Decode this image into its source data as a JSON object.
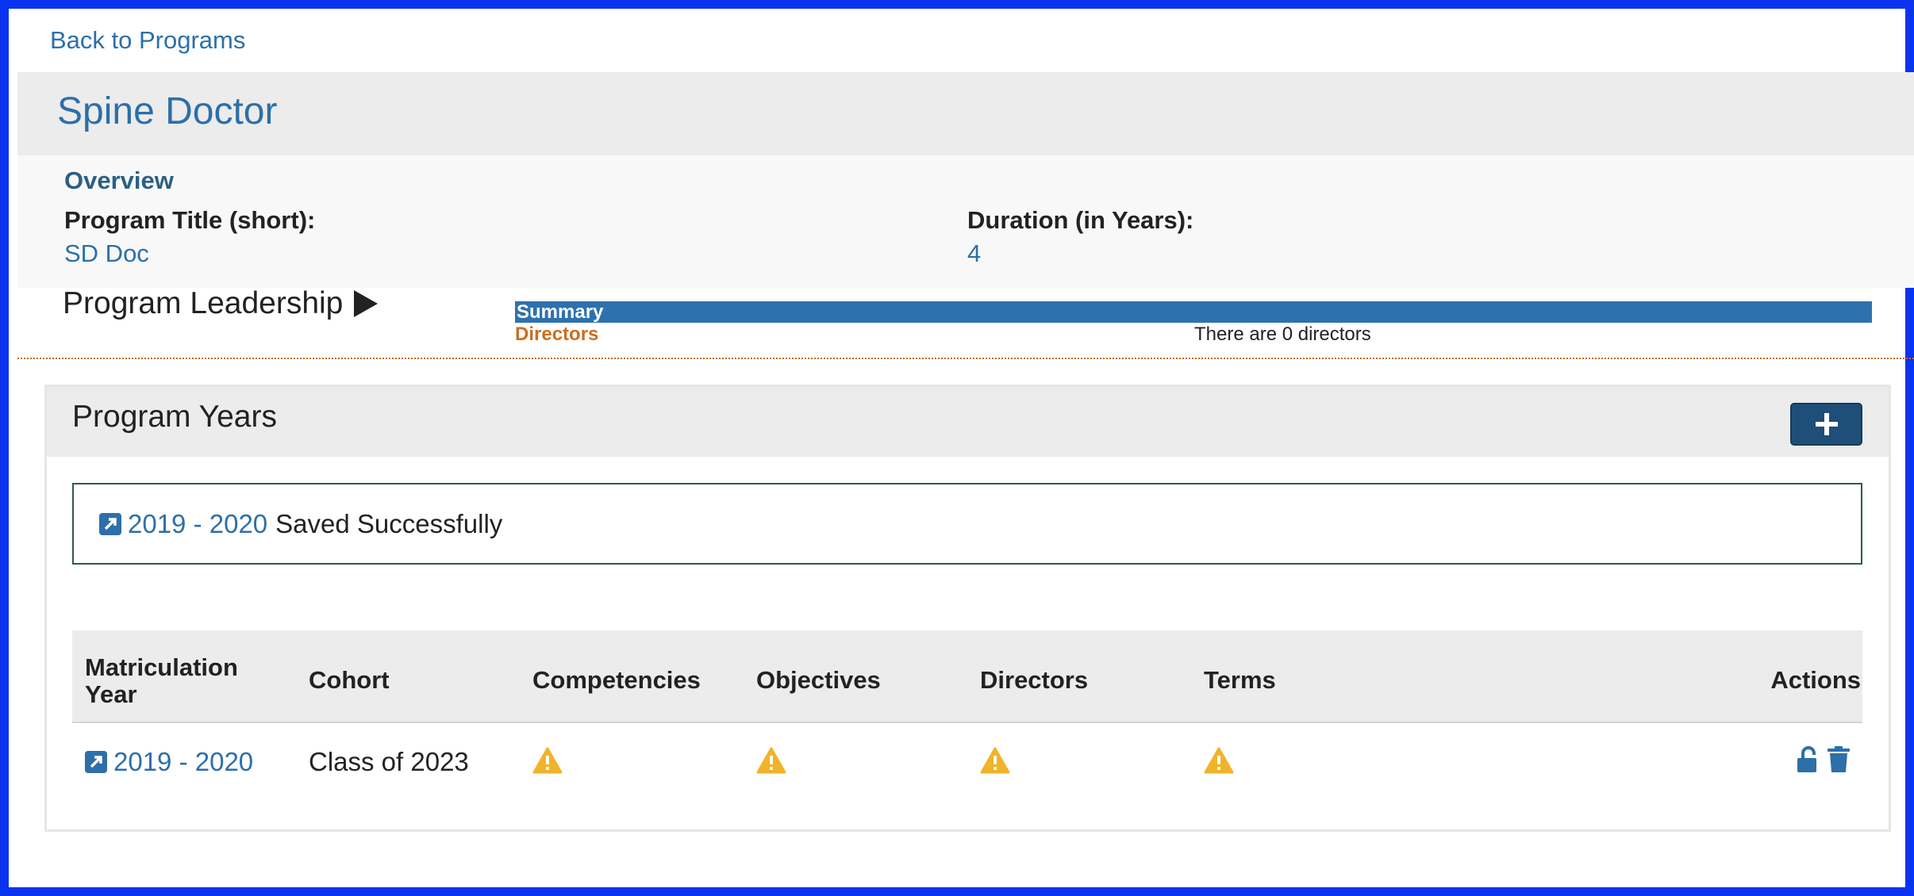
{
  "nav": {
    "back_link": "Back to Programs"
  },
  "program": {
    "title": "Spine Doctor"
  },
  "overview": {
    "heading": "Overview",
    "short_title_label": "Program Title (short):",
    "short_title_value": "SD Doc",
    "duration_label": "Duration (in Years):",
    "duration_value": "4"
  },
  "leadership": {
    "title": "Program Leadership",
    "summary_label": "Summary",
    "directors_label": "Directors",
    "directors_note": "There are 0 directors"
  },
  "program_years": {
    "title": "Program Years",
    "add_icon": "plus-icon",
    "saved": {
      "link": "2019 - 2020",
      "text": "Saved Successfully"
    },
    "columns": [
      "Matriculation Year",
      "Cohort",
      "Competencies",
      "Objectives",
      "Directors",
      "Terms",
      "Actions"
    ],
    "rows": [
      {
        "year": "2019 - 2020",
        "cohort": "Class of 2023",
        "competencies_icon": "warning-icon",
        "objectives_icon": "warning-icon",
        "directors_icon": "warning-icon",
        "terms_icon": "warning-icon",
        "actions": [
          "unlock-icon",
          "trash-icon"
        ]
      }
    ]
  },
  "colors": {
    "link": "#2d6fa9",
    "border": "#0a33f0",
    "summary_bar": "#2d72ae",
    "directors": "#cc6e1f",
    "warning": "#f0b429",
    "button": "#1f4e79"
  }
}
